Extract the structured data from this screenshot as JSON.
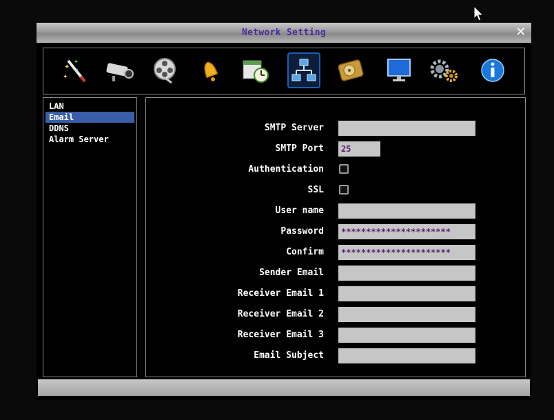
{
  "window": {
    "title": "Network Setting"
  },
  "toolbar": {
    "icons": [
      "wizard-wand-icon",
      "camera-icon",
      "film-reel-icon",
      "alarm-bell-icon",
      "schedule-clock-icon",
      "network-icon",
      "hard-disk-icon",
      "monitor-icon",
      "system-gears-icon",
      "info-icon"
    ],
    "selected": "network-icon"
  },
  "sidebar": {
    "items": [
      {
        "label": "LAN"
      },
      {
        "label": "Email"
      },
      {
        "label": "DDNS"
      },
      {
        "label": "Alarm Server"
      }
    ],
    "active": "Email"
  },
  "form": {
    "smtp_server": {
      "label": "SMTP Server",
      "value": ""
    },
    "smtp_port": {
      "label": "SMTP Port",
      "value": "25"
    },
    "authentication": {
      "label": "Authentication",
      "checked": false
    },
    "ssl": {
      "label": "SSL",
      "checked": false
    },
    "user_name": {
      "label": "User name",
      "value": ""
    },
    "password": {
      "label": "Password",
      "value": "**********************"
    },
    "confirm": {
      "label": "Confirm",
      "value": "**********************"
    },
    "sender_email": {
      "label": "Sender Email",
      "value": ""
    },
    "receiver_email_1": {
      "label": "Receiver Email 1",
      "value": ""
    },
    "receiver_email_2": {
      "label": "Receiver Email 2",
      "value": ""
    },
    "receiver_email_3": {
      "label": "Receiver Email 3",
      "value": ""
    },
    "email_subject": {
      "label": "Email Subject",
      "value": ""
    }
  },
  "colors": {
    "title_text": "#4a2a9c",
    "selection": "#3a5fa8",
    "field_bg": "#c6c6c6",
    "close_x": "#ffffff"
  }
}
